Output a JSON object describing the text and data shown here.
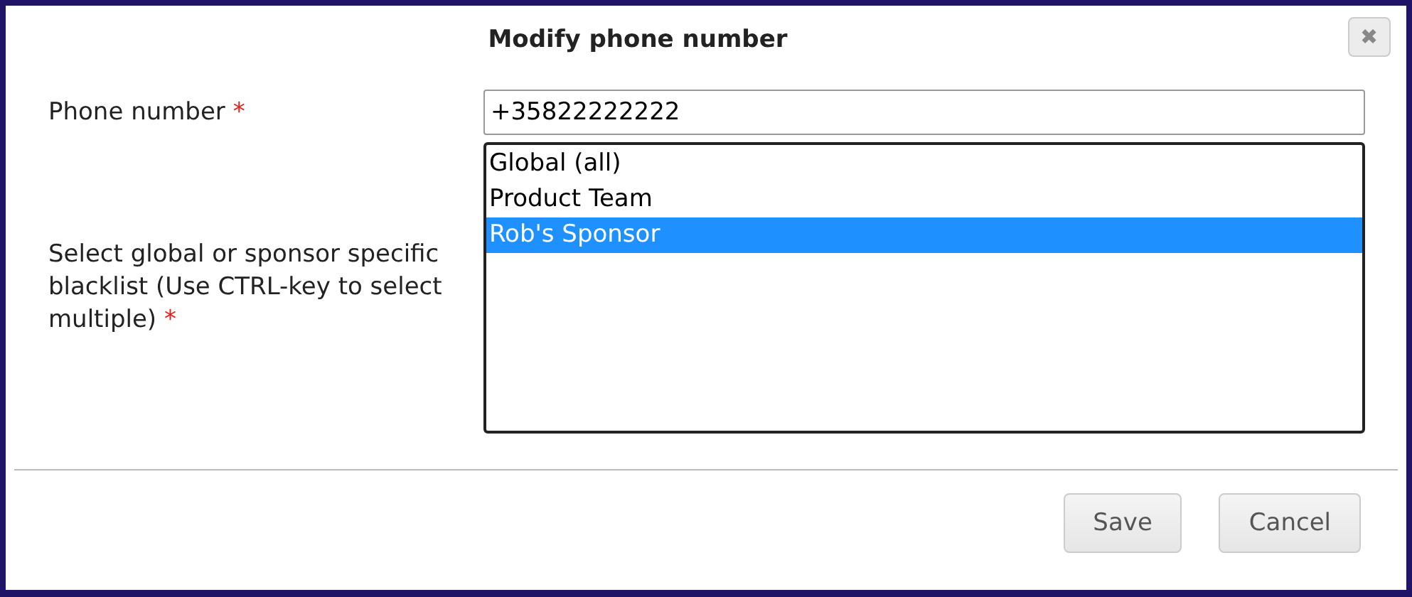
{
  "dialog": {
    "title": "Modify phone number",
    "close_icon": "✖"
  },
  "fields": [
    {
      "kind": "text",
      "label": "Phone number",
      "required_mark": "*",
      "value": "+35822222222"
    },
    {
      "kind": "listbox",
      "label": "Select global or sponsor specific blacklist (Use CTRL-key to select multiple)",
      "required_mark": "*",
      "options": [
        {
          "label": "Global (all)",
          "selected": false
        },
        {
          "label": "Product Team",
          "selected": false
        },
        {
          "label": "Rob's Sponsor",
          "selected": true
        }
      ]
    }
  ],
  "buttons": [
    "Save",
    "Cancel"
  ]
}
